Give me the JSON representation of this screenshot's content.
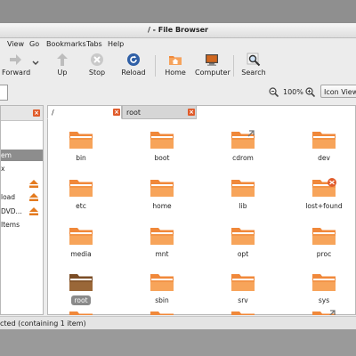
{
  "window": {
    "title": "/ - File Browser"
  },
  "menu": [
    "View",
    "Go",
    "Bookmarks",
    "Tabs",
    "Help"
  ],
  "toolbar": {
    "forward": "Forward",
    "up": "Up",
    "stop": "Stop",
    "reload": "Reload",
    "home": "Home",
    "computer": "Computer",
    "search": "Search"
  },
  "location": {
    "zoom": "100%",
    "view_mode": "Icon View"
  },
  "sidebar": {
    "items": [
      "em",
      "x",
      "",
      "load",
      "DVD...",
      "Items"
    ]
  },
  "tabs": [
    {
      "label": "/",
      "active": true
    },
    {
      "label": "root",
      "active": false
    }
  ],
  "files": [
    "bin",
    "boot",
    "cdrom",
    "dev",
    "etc",
    "home",
    "lib",
    "lost+found",
    "media",
    "mnt",
    "opt",
    "proc",
    "root",
    "sbin",
    "srv",
    "sys"
  ],
  "status": "cted (containing 1 item)",
  "colors": {
    "folder": "#f0883a",
    "folder_selected": "#8b5a30",
    "accent": "#e05b2a"
  }
}
